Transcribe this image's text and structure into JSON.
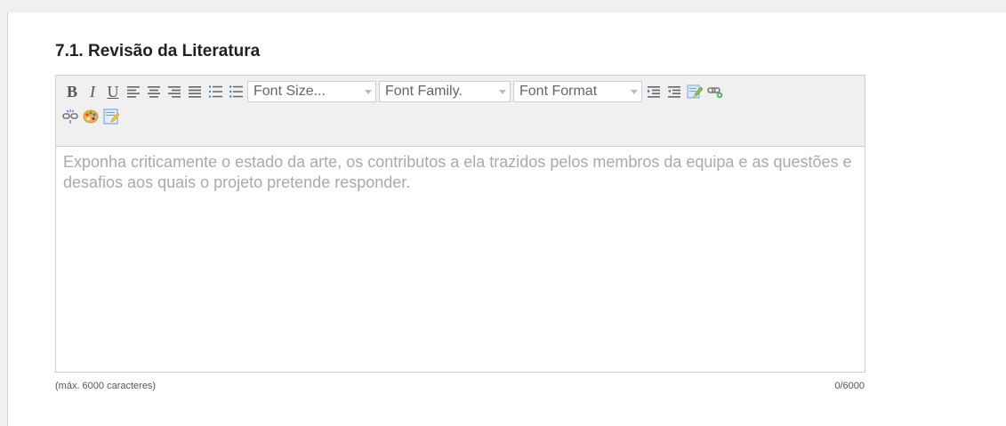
{
  "section": {
    "title": "7.1. Revisão da Literatura"
  },
  "toolbar": {
    "buttons_row1": [
      {
        "name": "bold-button",
        "icon": "bold-icon",
        "glyph": "B"
      },
      {
        "name": "italic-button",
        "icon": "italic-icon",
        "glyph": "I"
      },
      {
        "name": "underline-button",
        "icon": "underline-icon",
        "glyph": "U"
      }
    ],
    "font_size_label": "Font Size...",
    "font_family_label": "Font Family.",
    "font_format_label": "Font Format",
    "icons": {
      "align_left": "align-left-icon",
      "align_center": "align-center-icon",
      "align_right": "align-right-icon",
      "align_justify": "align-justify-icon",
      "ordered_list": "ordered-list-icon",
      "unordered_list": "unordered-list-icon",
      "indent": "indent-icon",
      "outdent": "outdent-icon",
      "edit": "edit-pencil-icon",
      "link": "link-icon",
      "unlink": "unlink-icon",
      "color": "color-palette-icon",
      "html_source": "html-source-icon"
    }
  },
  "editor": {
    "placeholder": "Exponha criticamente o estado da arte, os contributos a ela trazidos pelos membros da equipa e as questões e desafios aos quais o projeto pretende responder.",
    "value": ""
  },
  "footer": {
    "max_chars_label": "(máx. 6000 caracteres)",
    "counter": "0/6000"
  }
}
